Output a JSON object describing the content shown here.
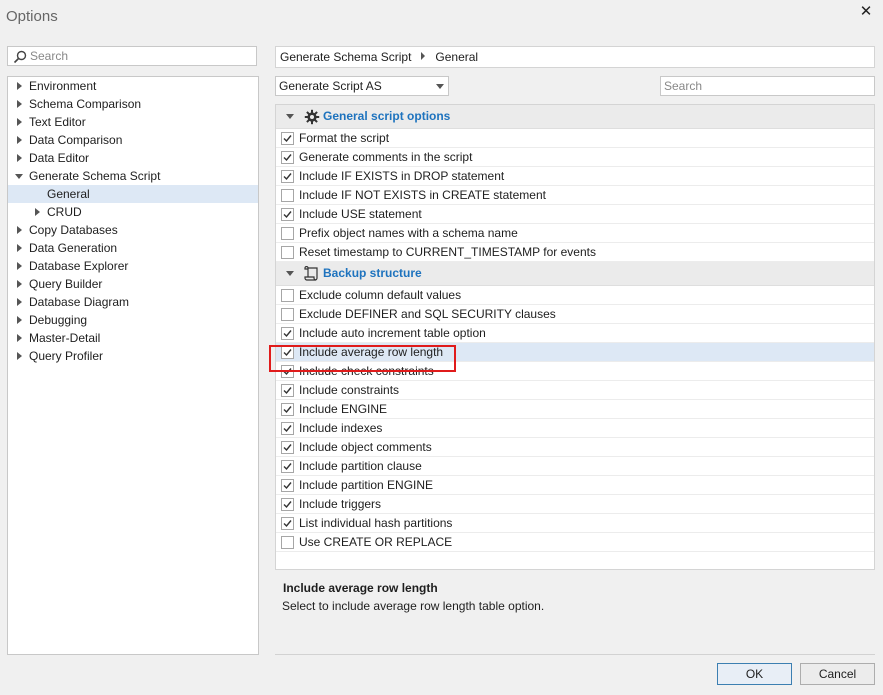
{
  "window": {
    "title": "Options",
    "close_glyph": "✕"
  },
  "left_search": {
    "placeholder": "Search",
    "value": ""
  },
  "tree": [
    {
      "label": "Environment",
      "expanded": false,
      "level": 0
    },
    {
      "label": "Schema Comparison",
      "expanded": false,
      "level": 0
    },
    {
      "label": "Text Editor",
      "expanded": false,
      "level": 0
    },
    {
      "label": "Data Comparison",
      "expanded": false,
      "level": 0
    },
    {
      "label": "Data Editor",
      "expanded": false,
      "level": 0
    },
    {
      "label": "Generate Schema Script",
      "expanded": true,
      "level": 0
    },
    {
      "label": "General",
      "level": 1,
      "leaf": true,
      "selected": true
    },
    {
      "label": "CRUD",
      "expanded": false,
      "level": 1
    },
    {
      "label": "Copy Databases",
      "expanded": false,
      "level": 0
    },
    {
      "label": "Data Generation",
      "expanded": false,
      "level": 0
    },
    {
      "label": "Database Explorer",
      "expanded": false,
      "level": 0
    },
    {
      "label": "Query Builder",
      "expanded": false,
      "level": 0
    },
    {
      "label": "Database Diagram",
      "expanded": false,
      "level": 0
    },
    {
      "label": "Debugging",
      "expanded": false,
      "level": 0
    },
    {
      "label": "Master-Detail",
      "expanded": false,
      "level": 0
    },
    {
      "label": "Query Profiler",
      "expanded": false,
      "level": 0
    }
  ],
  "breadcrumb": {
    "parent": "Generate Schema Script",
    "current": "General"
  },
  "script_as": {
    "value": "Generate Script AS"
  },
  "right_search": {
    "placeholder": "Search",
    "value": ""
  },
  "groups": [
    {
      "title": "General script options",
      "icon": "gear-icon",
      "options": [
        {
          "label": "Format the script",
          "checked": true
        },
        {
          "label": "Generate comments in the script",
          "checked": true
        },
        {
          "label": "Include IF EXISTS in DROP statement",
          "checked": true
        },
        {
          "label": "Include IF NOT EXISTS in CREATE statement",
          "checked": false
        },
        {
          "label": "Include USE statement",
          "checked": true
        },
        {
          "label": "Prefix object names with a schema name",
          "checked": false
        },
        {
          "label": "Reset timestamp to CURRENT_TIMESTAMP for events",
          "checked": false
        }
      ]
    },
    {
      "title": "Backup structure",
      "icon": "scroll-icon",
      "options": [
        {
          "label": "Exclude column default values",
          "checked": false
        },
        {
          "label": "Exclude DEFINER and SQL SECURITY clauses",
          "checked": false
        },
        {
          "label": "Include auto increment table option",
          "checked": true
        },
        {
          "label": "Include average row length",
          "checked": true,
          "highlighted": true
        },
        {
          "label": "Include check constraints",
          "checked": true
        },
        {
          "label": "Include constraints",
          "checked": true
        },
        {
          "label": "Include ENGINE",
          "checked": true
        },
        {
          "label": "Include indexes",
          "checked": true
        },
        {
          "label": "Include object comments",
          "checked": true
        },
        {
          "label": "Include partition clause",
          "checked": true
        },
        {
          "label": "Include partition ENGINE",
          "checked": true
        },
        {
          "label": "Include triggers",
          "checked": true
        },
        {
          "label": "List individual hash partitions",
          "checked": true
        },
        {
          "label": "Use CREATE OR REPLACE",
          "checked": false
        }
      ]
    }
  ],
  "description": {
    "title": "Include average row length",
    "text": "Select to include average row length table option."
  },
  "buttons": {
    "ok": "OK",
    "cancel": "Cancel"
  },
  "colors": {
    "accent": "#1e73be",
    "selection": "#dde8f5",
    "highlight_box": "#e01b1b"
  }
}
